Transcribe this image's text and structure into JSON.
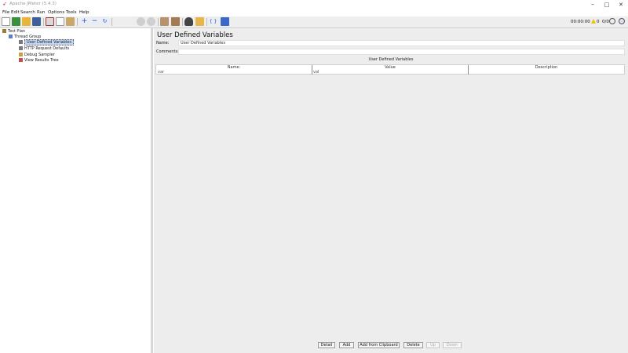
{
  "window": {
    "title": "Apache JMeter (5.4.3)",
    "controls": {
      "minimize": "–",
      "maximize": "□",
      "close": "✕"
    }
  },
  "menu": [
    "File",
    "Edit",
    "Search",
    "Run",
    "Options",
    "Tools",
    "Help"
  ],
  "toolbar": {
    "icons": [
      "new-icon",
      "templates-icon",
      "open-icon",
      "save-icon",
      "cut-icon",
      "copy-icon",
      "paste-icon",
      "expand-icon",
      "collapse-icon",
      "toggle-icon",
      "start-icon",
      "start-no-pauses-icon",
      "stop-icon",
      "shutdown-icon",
      "clear-icon",
      "clear-all-icon",
      "search-icon",
      "reset-search-icon",
      "function-helper-icon",
      "help-icon"
    ],
    "timer": "00:00:00",
    "warning_count": "0",
    "thread_count": "0/0"
  },
  "tree": {
    "items": [
      {
        "label": "Test Plan",
        "level": 0
      },
      {
        "label": "Thread Group",
        "level": 1
      },
      {
        "label": "User Defined Variables",
        "level": 2,
        "selected": true
      },
      {
        "label": "HTTP Request Defaults",
        "level": 2
      },
      {
        "label": "Debug Sampler",
        "level": 2
      },
      {
        "label": "View Results Tree",
        "level": 2
      }
    ]
  },
  "panel": {
    "title": "User Defined Variables",
    "name_label": "Name:",
    "name_value": "User Defined Variables",
    "comments_label": "Comments:",
    "comments_value": "",
    "table_caption": "User Defined Variables",
    "columns": [
      "Name:",
      "Value",
      "Description"
    ],
    "rows": [
      {
        "name": "var",
        "value": "val",
        "description": ""
      }
    ]
  },
  "buttons": {
    "detail": "Detail",
    "add": "Add",
    "add_clipboard": "Add from Clipboard",
    "delete": "Delete",
    "up": "Up",
    "down": "Down"
  },
  "colors": {
    "accent_run": "#1e9a2c",
    "selection": "#c5d7ee",
    "panel_bg": "#ededed"
  }
}
